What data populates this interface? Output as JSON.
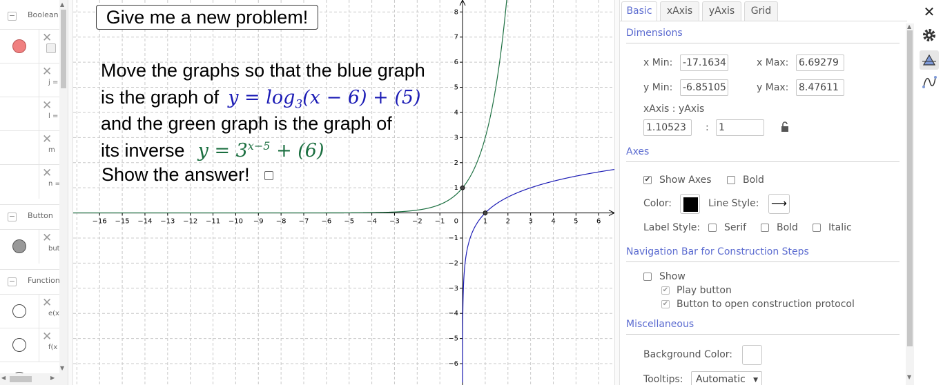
{
  "algebra": {
    "categories": [
      {
        "label": "Boolean"
      },
      {
        "label": "Button"
      },
      {
        "label": "Function"
      }
    ],
    "rows": [
      {
        "def": "",
        "color": "#f08080",
        "filled": true
      },
      {
        "def": "j =",
        "color": "",
        "filled": false
      },
      {
        "def": "l =",
        "color": "",
        "filled": false
      },
      {
        "def": "m",
        "color": "",
        "filled": false
      },
      {
        "def": "n =",
        "color": "",
        "filled": false
      },
      {
        "def": "but",
        "color": "#999999",
        "filled": true
      },
      {
        "def": "e(x",
        "color": "",
        "filled": false
      },
      {
        "def": "f(x",
        "color": "",
        "filled": false
      }
    ],
    "collapse_symbol": "−",
    "delete_symbol": "✕"
  },
  "graphics": {
    "button_label": "Give me a new problem!",
    "line1": "Move the graphs so that the blue graph",
    "line2_text": "is the graph of",
    "line2_formula": "y = log",
    "line2_sub": "3",
    "line2_rest": "(x − 6) + (5)",
    "line3": "and the green graph is the graph of",
    "line4_text": "its inverse",
    "line4_formula": "y = 3",
    "line4_sup": "x−5",
    "line4_rest": " + (6)",
    "show_answer": "Show the answer!",
    "colors": {
      "blue": "#1b1bb5",
      "green": "#1a6e3f",
      "grid": "#c8c8c8"
    }
  },
  "chart_data": {
    "type": "line",
    "xlim": [
      -17.1634,
      6.69279
    ],
    "ylim": [
      -6.85105,
      8.47611
    ],
    "x_ticks": [
      -16,
      -15,
      -14,
      -13,
      -12,
      -11,
      -10,
      -9,
      -8,
      -7,
      -6,
      -5,
      -4,
      -3,
      -2,
      -1,
      1,
      2,
      3,
      4,
      5,
      6
    ],
    "y_ticks": [
      -6,
      -5,
      -4,
      -3,
      -2,
      -1,
      1,
      2,
      3,
      4,
      5,
      6,
      7,
      8
    ],
    "origin_label": "0",
    "grid": true,
    "series": [
      {
        "function": "log3(x)",
        "color": "#1b1bb5"
      },
      {
        "function": "3^x",
        "color": "#1a6e3f"
      }
    ],
    "points": [
      [
        0,
        1
      ],
      [
        1,
        0
      ]
    ]
  },
  "props": {
    "tabs": [
      "Basic",
      "xAxis",
      "yAxis",
      "Grid"
    ],
    "dimensions": {
      "title": "Dimensions",
      "xmin_label": "x Min:",
      "xmin": "-17.1634",
      "xmax_label": "x Max:",
      "xmax": "6.69279",
      "ymin_label": "y Min:",
      "ymin": "-6.85105",
      "ymax_label": "y Max:",
      "ymax": "8.47611",
      "ratio_label": "xAxis : yAxis",
      "ratio_x": "1.10523",
      "ratio_sep": ":",
      "ratio_y": "1"
    },
    "axes": {
      "title": "Axes",
      "show_axes": "Show Axes",
      "bold": "Bold",
      "color_label": "Color:",
      "color_value": "#000000",
      "line_style_label": "Line Style:",
      "line_style_glyph": "⟶",
      "label_style_label": "Label Style:",
      "serif": "Serif",
      "bold2": "Bold",
      "italic": "Italic"
    },
    "navigation": {
      "title": "Navigation Bar for Construction Steps",
      "show": "Show",
      "play": "Play button",
      "protocol": "Button to open construction protocol"
    },
    "misc": {
      "title": "Miscellaneous",
      "bg_label": "Background Color:",
      "tooltips_label": "Tooltips:",
      "tooltips_value": "Automatic"
    }
  },
  "toolbar": {
    "close": "✕",
    "gear": "gear",
    "graphics": "graphics",
    "algebra": "algebra"
  }
}
